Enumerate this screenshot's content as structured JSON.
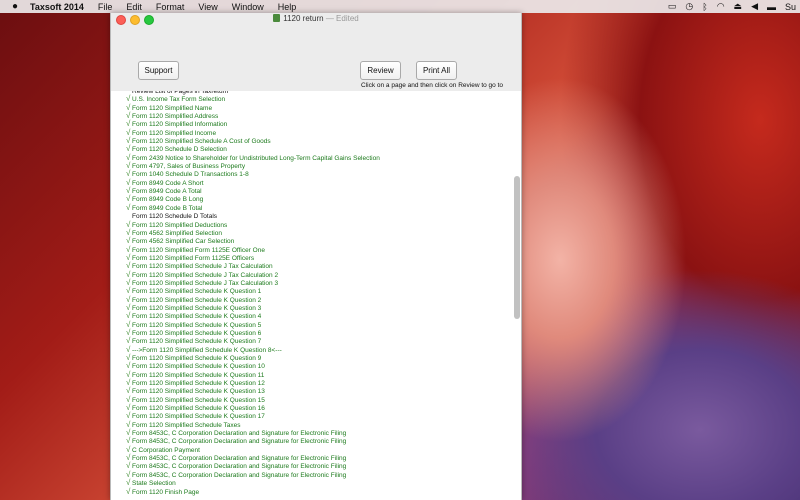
{
  "menubar": {
    "apple": "",
    "app_name": "Taxsoft 2014",
    "items": [
      "File",
      "Edit",
      "Format",
      "View",
      "Window",
      "Help"
    ],
    "right_truncated": "Su"
  },
  "window": {
    "title": "1120 return",
    "title_separator": "—",
    "title_status": "Edited"
  },
  "buttons": {
    "support": "Support",
    "review": "Review",
    "print_all": "Print All"
  },
  "hint_text": "Click on a page and then click on Review to go to",
  "list": {
    "rows": [
      {
        "label": "Review List of Pages in Taxreturn",
        "checked": false
      },
      {
        "label": "U.S. Income Tax Form Selection",
        "checked": true
      },
      {
        "label": "Form 1120 Simplified Name",
        "checked": true
      },
      {
        "label": "Form 1120 Simplified Address",
        "checked": true
      },
      {
        "label": "Form 1120 Simplified Information",
        "checked": true
      },
      {
        "label": "Form 1120 Simplified Income",
        "checked": true
      },
      {
        "label": "Form 1120 Simplified Schedule A Cost of Goods",
        "checked": true
      },
      {
        "label": "Form 1120 Schedule D Selection",
        "checked": true
      },
      {
        "label": "Form 2439 Notice to Shareholder for Undistributed Long-Term Capital Gains Selection",
        "checked": true
      },
      {
        "label": "Form 4797, Sales of Business Property",
        "checked": true
      },
      {
        "label": "Form 1040 Schedule D Transactions 1-8",
        "checked": true
      },
      {
        "label": "Form 8949 Code A Short",
        "checked": true
      },
      {
        "label": "Form 8949 Code A Total",
        "checked": true
      },
      {
        "label": "Form 8949 Code B Long",
        "checked": true
      },
      {
        "label": "Form 8949 Code B Total",
        "checked": true
      },
      {
        "label": "Form 1120 Schedule D Totals",
        "checked": false
      },
      {
        "label": "Form 1120 Simplified Deductions",
        "checked": true
      },
      {
        "label": "Form 4562 Simplified Selection",
        "checked": true
      },
      {
        "label": "Form 4562 Simplified Car Selection",
        "checked": true
      },
      {
        "label": "Form 1120 Simplified Form 1125E Officer One",
        "checked": true
      },
      {
        "label": "Form 1120 Simplified Form 1125E Officers",
        "checked": true
      },
      {
        "label": "Form 1120 Simplified Schedule J Tax Calculation",
        "checked": true
      },
      {
        "label": "Form 1120 Simplified Schedule J Tax Calculation 2",
        "checked": true
      },
      {
        "label": "Form 1120 Simplified Schedule J Tax Calculation 3",
        "checked": true
      },
      {
        "label": "Form 1120 Simplified Schedule K Question 1",
        "checked": true
      },
      {
        "label": "Form 1120 Simplified Schedule K Question 2",
        "checked": true
      },
      {
        "label": "Form 1120 Simplified Schedule K Question 3",
        "checked": true
      },
      {
        "label": "Form 1120 Simplified Schedule K Question 4",
        "checked": true
      },
      {
        "label": "Form 1120 Simplified Schedule K Question 5",
        "checked": true
      },
      {
        "label": "Form 1120 Simplified Schedule K Question 6",
        "checked": true
      },
      {
        "label": "Form 1120 Simplified Schedule K Question 7",
        "checked": true
      },
      {
        "label": "--->Form 1120 Simplified Schedule K Question 8<---",
        "checked": true
      },
      {
        "label": "Form 1120 Simplified Schedule K Question 9",
        "checked": true
      },
      {
        "label": "Form 1120 Simplified Schedule K Question 10",
        "checked": true
      },
      {
        "label": "Form 1120 Simplified Schedule K Question 11",
        "checked": true
      },
      {
        "label": "Form 1120 Simplified Schedule K Question 12",
        "checked": true
      },
      {
        "label": "Form 1120 Simplified Schedule K Question 13",
        "checked": true
      },
      {
        "label": "Form 1120 Simplified Schedule K Question 15",
        "checked": true
      },
      {
        "label": "Form 1120 Simplified Schedule K Question 16",
        "checked": true
      },
      {
        "label": "Form 1120 Simplified Schedule K Question 17",
        "checked": true
      },
      {
        "label": "Form 1120 Simplified Schedule Taxes",
        "checked": true
      },
      {
        "label": "Form 8453C, C Corporation Declaration and Signature for Electronic Filing",
        "checked": true
      },
      {
        "label": "Form 8453C, C Corporation Declaration and Signature for Electronic Filing",
        "checked": true
      },
      {
        "label": "C Corporation Payment",
        "checked": true
      },
      {
        "label": "Form 8453C, C Corporation Declaration and Signature for Electronic Filing",
        "checked": true
      },
      {
        "label": "Form 8453C, C Corporation Declaration and Signature for Electronic Filing",
        "checked": true
      },
      {
        "label": "Form 8453C, C Corporation Declaration and Signature for Electronic Filing",
        "checked": true
      },
      {
        "label": "State Selection",
        "checked": true
      },
      {
        "label": "Form 1120 Finish Page",
        "checked": true
      }
    ]
  },
  "colors": {
    "done_text": "#1c7a1c",
    "checkmark": "#3c8a2e"
  }
}
